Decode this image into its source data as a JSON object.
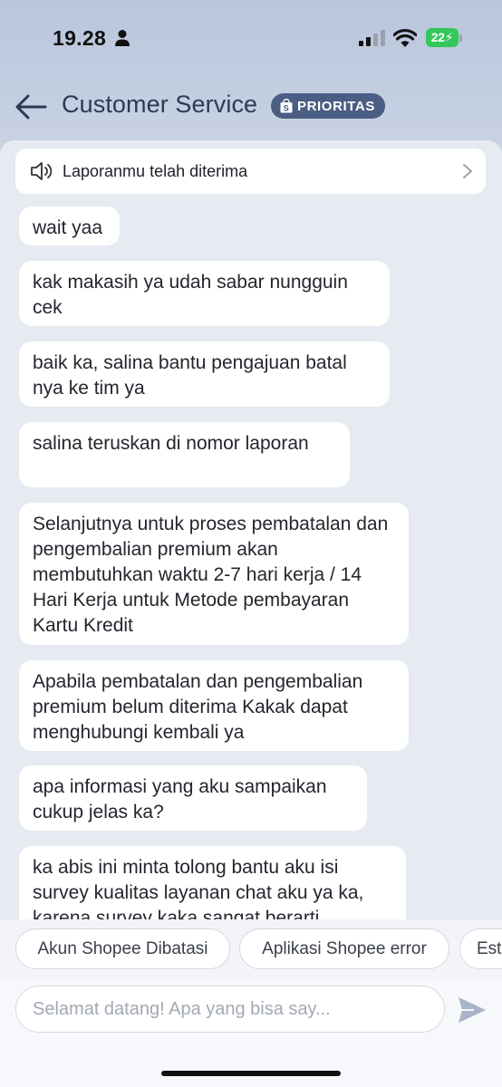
{
  "status_bar": {
    "time": "19.28",
    "battery": "22⚡"
  },
  "header": {
    "title": "Customer Service",
    "badge": "PRIORITAS"
  },
  "notice": {
    "text": "Laporanmu telah diterima"
  },
  "messages": [
    "wait yaa",
    "kak makasih ya udah sabar nungguin cek",
    "baik ka, salina bantu pengajuan batal nya ke tim ya",
    "salina teruskan di nomor laporan",
    "Selanjutnya untuk proses pembatalan dan pengembalian premium akan membutuhkan waktu 2-7 hari kerja / 14 Hari Kerja untuk Metode pembayaran Kartu Kredit",
    "Apabila pembatalan dan pengembalian premium belum diterima Kakak dapat menghubungi kembali ya",
    "apa informasi yang aku sampaikan cukup jelas ka?",
    "ka abis ini minta tolong bantu aku isi survey kualitas layanan chat aku ya ka, karena survey kaka sangat berarti"
  ],
  "quick_replies": [
    "Akun Shopee Dibatasi",
    "Aplikasi Shopee error",
    "Est"
  ],
  "input": {
    "placeholder": "Selamat datang! Apa yang bisa say..."
  },
  "colors": {
    "badge_bg": "#4a5d82",
    "battery_green": "#34c759",
    "send_icon": "#a9b4c8"
  },
  "icons": [
    "person-icon",
    "signal-icon",
    "wifi-icon",
    "back-arrow-icon",
    "shopping-bag-icon",
    "speaker-icon",
    "chevron-right-icon",
    "send-icon"
  ]
}
